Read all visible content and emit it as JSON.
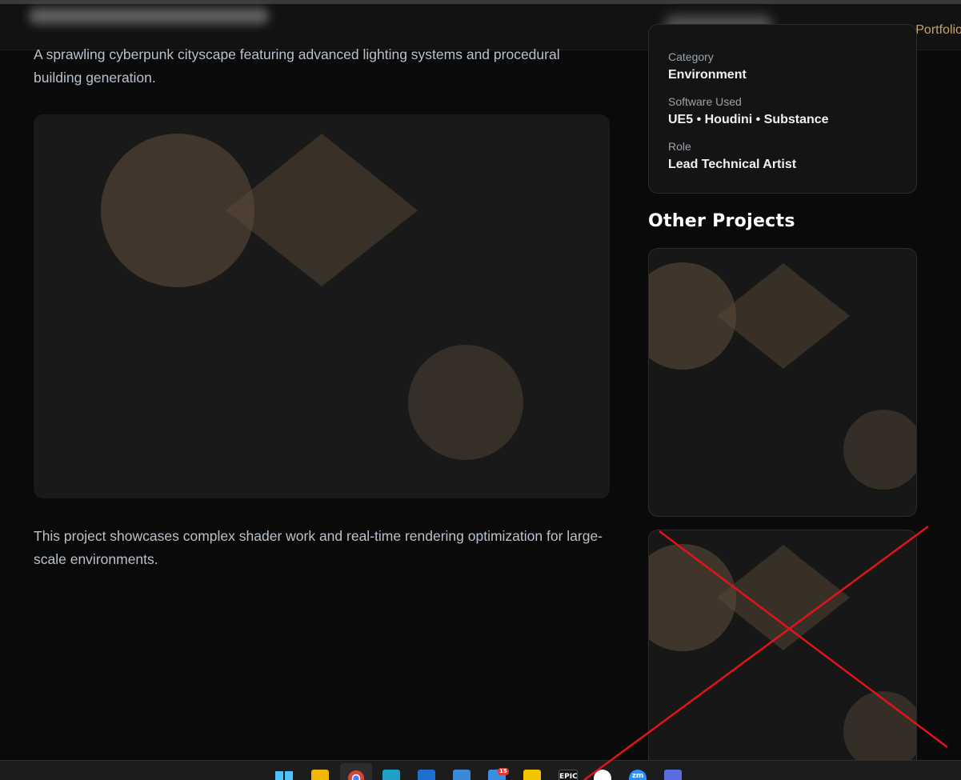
{
  "header": {
    "back_link": "← Back to Portfolio"
  },
  "project": {
    "lead": "A sprawling cyberpunk cityscape featuring advanced lighting systems and procedural building generation.",
    "body": "This project showcases complex shader work and real-time rendering optimization for large-scale environments."
  },
  "info": {
    "category_label": "Category",
    "category_value": "Environment",
    "software_label": "Software Used",
    "software_value": "UE5 • Houdini • Substance",
    "role_label": "Role",
    "role_value": "Lead Technical Artist"
  },
  "other_projects": {
    "title": "Other Projects"
  },
  "taskbar": {
    "epic_label": "EPIC",
    "zoom_label": "zm",
    "mail_badge": "15"
  },
  "colors": {
    "accent": "#c9a26a",
    "background": "#0a0a0a",
    "card": "#141414",
    "shape": "#5a4a38",
    "annotation": "#e0141a"
  }
}
